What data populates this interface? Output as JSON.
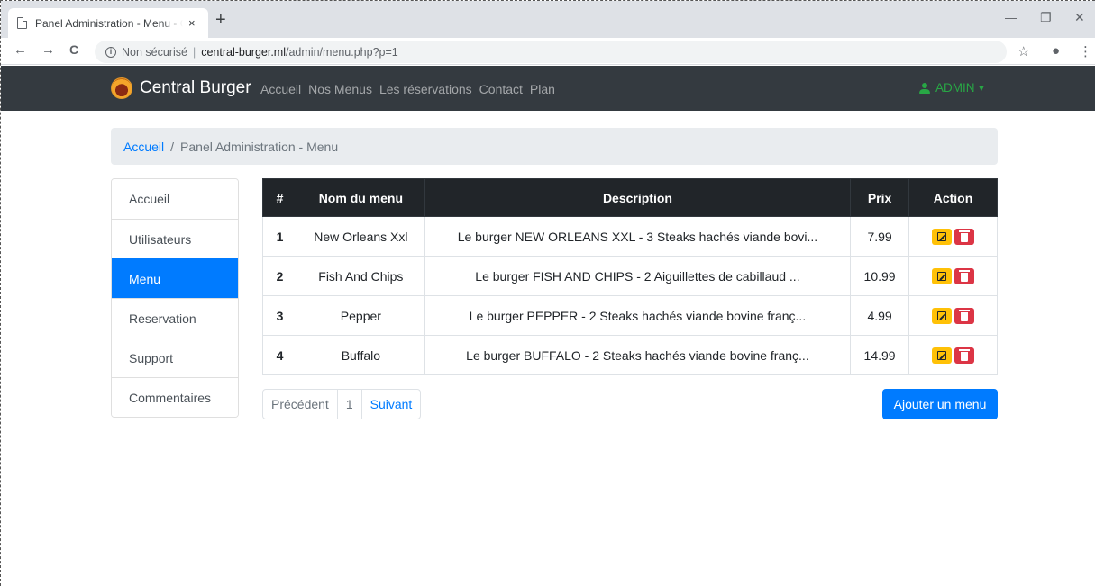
{
  "browser": {
    "tab_title": "Panel Administration - Menu - Ce",
    "tab_close": "×",
    "new_tab": "+",
    "back": "←",
    "forward": "→",
    "reload": "C",
    "security_label": "Non sécurisé",
    "url_host": "central-burger.ml",
    "url_path": "/admin/menu.php?p=1",
    "star": "☆",
    "account": "●",
    "more": "⋮",
    "minimize": "—",
    "restore": "❐",
    "close": "✕"
  },
  "navbar": {
    "brand": "Central Burger",
    "links": [
      "Accueil",
      "Nos Menus",
      "Les réservations",
      "Contact",
      "Plan"
    ],
    "admin_label": "ADMIN"
  },
  "breadcrumb": {
    "home": "Accueil",
    "separator": "/",
    "current": "Panel Administration - Menu"
  },
  "sidebar": {
    "items": [
      {
        "label": "Accueil",
        "active": false
      },
      {
        "label": "Utilisateurs",
        "active": false
      },
      {
        "label": "Menu",
        "active": true
      },
      {
        "label": "Reservation",
        "active": false
      },
      {
        "label": "Support",
        "active": false
      },
      {
        "label": "Commentaires",
        "active": false
      }
    ]
  },
  "table": {
    "headers": [
      "#",
      "Nom du menu",
      "Description",
      "Prix",
      "Action"
    ],
    "rows": [
      {
        "id": "1",
        "name": "New Orleans Xxl",
        "description": "Le burger NEW ORLEANS XXL - 3 Steaks hachés viande bovi...",
        "price": "7.99"
      },
      {
        "id": "2",
        "name": "Fish And Chips",
        "description": "Le burger FISH AND CHIPS - 2 Aiguillettes de cabillaud ...",
        "price": "10.99"
      },
      {
        "id": "3",
        "name": "Pepper",
        "description": "Le burger PEPPER - 2 Steaks hachés viande bovine franç...",
        "price": "4.99"
      },
      {
        "id": "4",
        "name": "Buffalo",
        "description": "Le burger BUFFALO - 2 Steaks hachés viande bovine franç...",
        "price": "14.99"
      }
    ]
  },
  "pagination": {
    "prev": "Précédent",
    "page": "1",
    "next": "Suivant"
  },
  "actions": {
    "add_menu": "Ajouter un menu"
  },
  "colors": {
    "primary": "#007bff",
    "navbar_bg": "#343a40",
    "edit": "#ffc107",
    "delete": "#dc3545",
    "admin": "#28a745"
  }
}
